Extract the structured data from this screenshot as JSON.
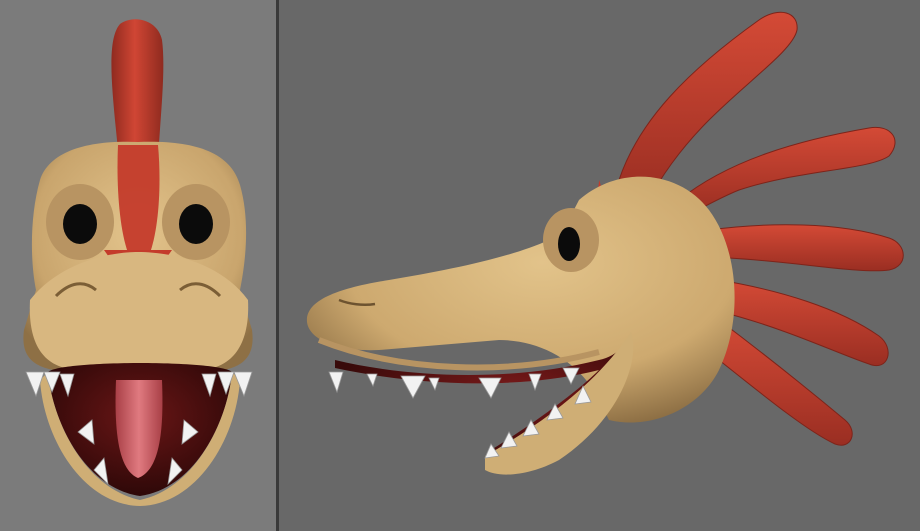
{
  "colors": {
    "front_background": "#7b7b7b",
    "side_background": "#686868",
    "divider": "#3a3a3a",
    "skin": "#d4b27a",
    "skin_shadow": "#a88651",
    "crest_red": "#c43b2b",
    "crest_red_dark": "#8f2a1f",
    "eye": "#0b0b0b",
    "eye_socket": "#b89462",
    "mouth_interior": "#4a0f0f",
    "tongue": "#c65a5f",
    "tooth": "#f2f2f2"
  },
  "views": [
    {
      "id": "front",
      "subject": "creature-head-front-icon"
    },
    {
      "id": "side",
      "subject": "creature-head-side-icon"
    }
  ]
}
